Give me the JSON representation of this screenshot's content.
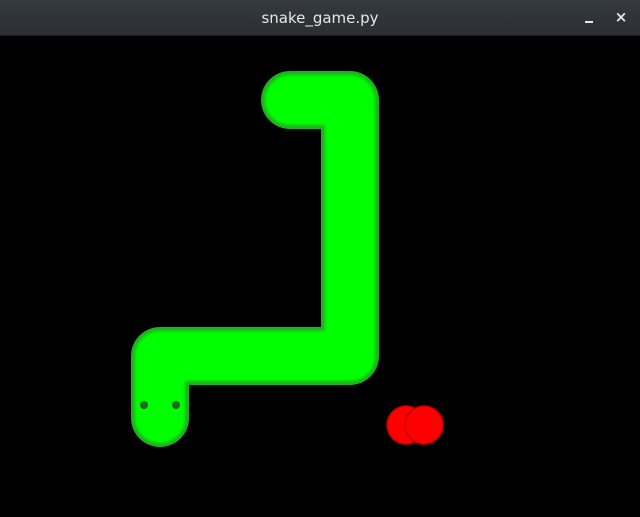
{
  "window": {
    "title": "snake_game.py",
    "minimize_icon": "minimize-icon",
    "close_icon": "close-icon",
    "close_glyph": "×"
  },
  "game": {
    "background_color": "#000000",
    "snake": {
      "body_color": "#00ff00",
      "outline_color": "#1db31d",
      "eye_color": "#1a6b1a",
      "direction": "down",
      "segments": 11
    },
    "food": {
      "type": "apple",
      "color": "#ff0000",
      "outline_color": "#c00000"
    }
  }
}
